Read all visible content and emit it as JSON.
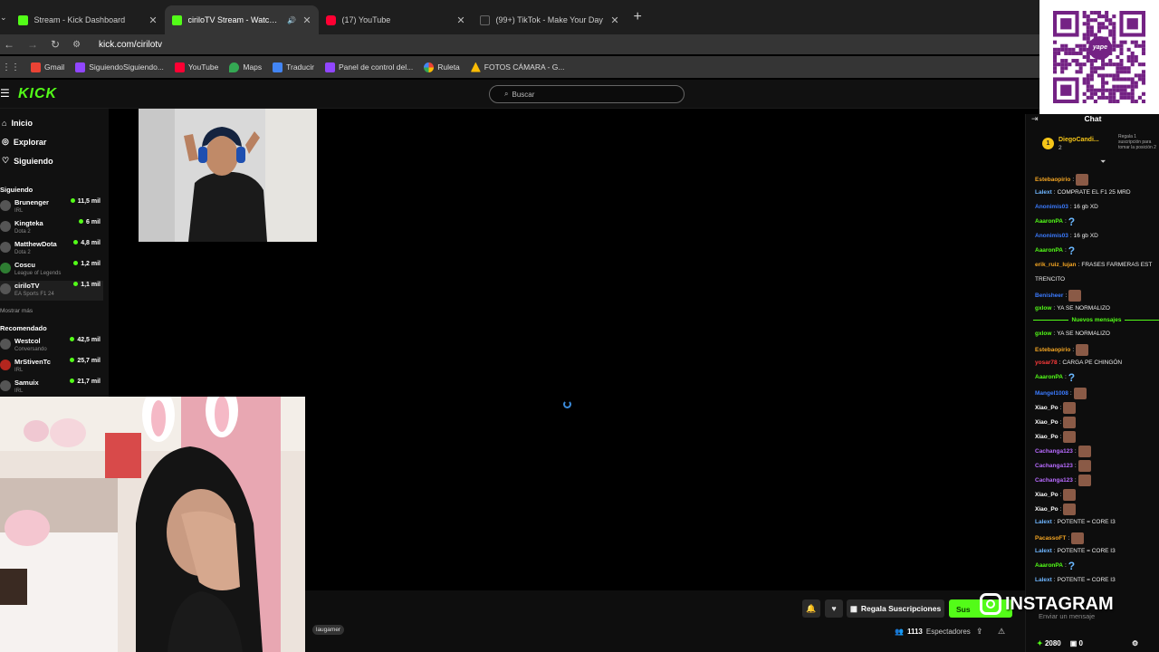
{
  "browser": {
    "tabs": [
      {
        "title": "Stream - Kick Dashboard",
        "favicon_color": "#53fc18"
      },
      {
        "title": "ciriloTV Stream - Watch Live",
        "favicon_color": "#53fc18",
        "active": true
      },
      {
        "title": "(17) YouTube",
        "favicon_color": "#ff0033"
      },
      {
        "title": "(99+) TikTok - Make Your Day",
        "favicon_color": "#000000"
      }
    ],
    "url": "kick.com/cirilotv",
    "bookmarks": [
      "Gmail",
      "SiguiendoSiguiendo...",
      "YouTube",
      "Maps",
      "Traducir",
      "Panel de control del...",
      "Ruleta",
      "FOTOS CÁMARA - G..."
    ]
  },
  "kick": {
    "logo": "KICK",
    "search_placeholder": "Buscar",
    "nav": {
      "home": "Inicio",
      "explore": "Explorar",
      "following": "Siguiendo"
    },
    "following_header": "Siguiendo",
    "following": [
      {
        "name": "Brunenger",
        "category": "IRL",
        "viewers": "11,5 mil"
      },
      {
        "name": "Kingteka",
        "category": "Dota 2",
        "viewers": "6 mil"
      },
      {
        "name": "MatthewDota",
        "category": "Dota 2",
        "viewers": "4,8 mil"
      },
      {
        "name": "Coscu",
        "category": "League of Legends",
        "viewers": "1,2 mil"
      },
      {
        "name": "ciriloTV",
        "category": "EA Sports F1 24",
        "viewers": "1,1 mil"
      }
    ],
    "show_more": "Mostrar más",
    "recommended_header": "Recomendado",
    "recommended": [
      {
        "name": "Westcol",
        "category": "Conversando",
        "viewers": "42,5 mil"
      },
      {
        "name": "MrStivenTc",
        "category": "IRL",
        "viewers": "25,7 mil"
      },
      {
        "name": "Samuix",
        "category": "IRL",
        "viewers": "21,7 mil"
      }
    ],
    "gift_label": "Regala Suscripciones",
    "sub_label": "Sus",
    "viewer_count": "1113",
    "viewer_label": "Espectadores",
    "stream_tag": "laugamer"
  },
  "chat": {
    "title": "Chat",
    "pinned": {
      "rank": "1",
      "user": "DiegoCandi...",
      "count": "2",
      "note": "Regala 1 suscripción para tomar la posición 2"
    },
    "messages": [
      {
        "user": "Estebaopirio",
        "color": "#f5a623",
        "text": "",
        "emote": "face"
      },
      {
        "user": "Lalext",
        "color": "#6fb6ff",
        "text": "COMPRATE EL F1 25 MRD",
        "emote": ""
      },
      {
        "user": "Anonimis03",
        "color": "#3b7bff",
        "text": "16 gb XD",
        "emote": ""
      },
      {
        "user": "AaaronPA",
        "color": "#53fc18",
        "text": "",
        "emote": "question"
      },
      {
        "user": "Anonimis03",
        "color": "#3b7bff",
        "text": "16 gb XD",
        "emote": ""
      },
      {
        "user": "AaaronPA",
        "color": "#53fc18",
        "text": "",
        "emote": "question"
      },
      {
        "user": "erik_ruiz_lujan",
        "color": "#f5a623",
        "text": "FRASES FARMERAS EST",
        "emote": ""
      },
      {
        "user": "",
        "color": "#ffffff",
        "text": "TRENCITO",
        "emote": ""
      },
      {
        "user": "Benisheer",
        "color": "#3b7bff",
        "text": "",
        "emote": "face"
      },
      {
        "user": "gxlow",
        "color": "#53fc18",
        "text": "YA SE NORMALIZO",
        "emote": ""
      }
    ],
    "new_messages_label": "Nuevos mensajes",
    "messages2": [
      {
        "user": "gxlow",
        "color": "#53fc18",
        "text": "YA SE NORMALIZO",
        "emote": ""
      },
      {
        "user": "Estebaopirio",
        "color": "#f5a623",
        "text": "",
        "emote": "face"
      },
      {
        "user": "yosar78",
        "color": "#ff3b3b",
        "text": "CARGA PE CHINGÓN",
        "emote": ""
      },
      {
        "user": "AaaronPA",
        "color": "#53fc18",
        "text": "",
        "emote": "question"
      },
      {
        "user": "Mangel1008",
        "color": "#3b7bff",
        "text": "",
        "emote": "face"
      },
      {
        "user": "Xiao_Po",
        "color": "#ffffff",
        "text": "",
        "emote": "face"
      },
      {
        "user": "Xiao_Po",
        "color": "#ffffff",
        "text": "",
        "emote": "face"
      },
      {
        "user": "Xiao_Po",
        "color": "#ffffff",
        "text": "",
        "emote": "face"
      },
      {
        "user": "Cachanga123",
        "color": "#b86bff",
        "text": "",
        "emote": "face"
      },
      {
        "user": "Cachanga123",
        "color": "#b86bff",
        "text": "",
        "emote": "face"
      },
      {
        "user": "Cachanga123",
        "color": "#b86bff",
        "text": "",
        "emote": "face"
      },
      {
        "user": "Xiao_Po",
        "color": "#ffffff",
        "text": "",
        "emote": "face"
      },
      {
        "user": "Xiao_Po",
        "color": "#ffffff",
        "text": "",
        "emote": "face"
      },
      {
        "user": "Lalext",
        "color": "#6fb6ff",
        "text": "POTENTE = CORE I3",
        "emote": ""
      },
      {
        "user": "PacassoFT",
        "color": "#f5a623",
        "text": "",
        "emote": "face"
      },
      {
        "user": "Lalext",
        "color": "#6fb6ff",
        "text": "POTENTE = CORE I3",
        "emote": ""
      },
      {
        "user": "AaaronPA",
        "color": "#53fc18",
        "text": "",
        "emote": "question"
      },
      {
        "user": "Lalext",
        "color": "#6fb6ff",
        "text": "POTENTE = CORE I3",
        "emote": ""
      }
    ],
    "input_placeholder": "Enviar un mensaje",
    "points": "2080",
    "other_count": "0"
  },
  "overlay": {
    "instagram": "INSTAGRAM",
    "qr_brand": "yape"
  },
  "colors": {
    "kick_green": "#53fc18",
    "background": "#000000"
  }
}
